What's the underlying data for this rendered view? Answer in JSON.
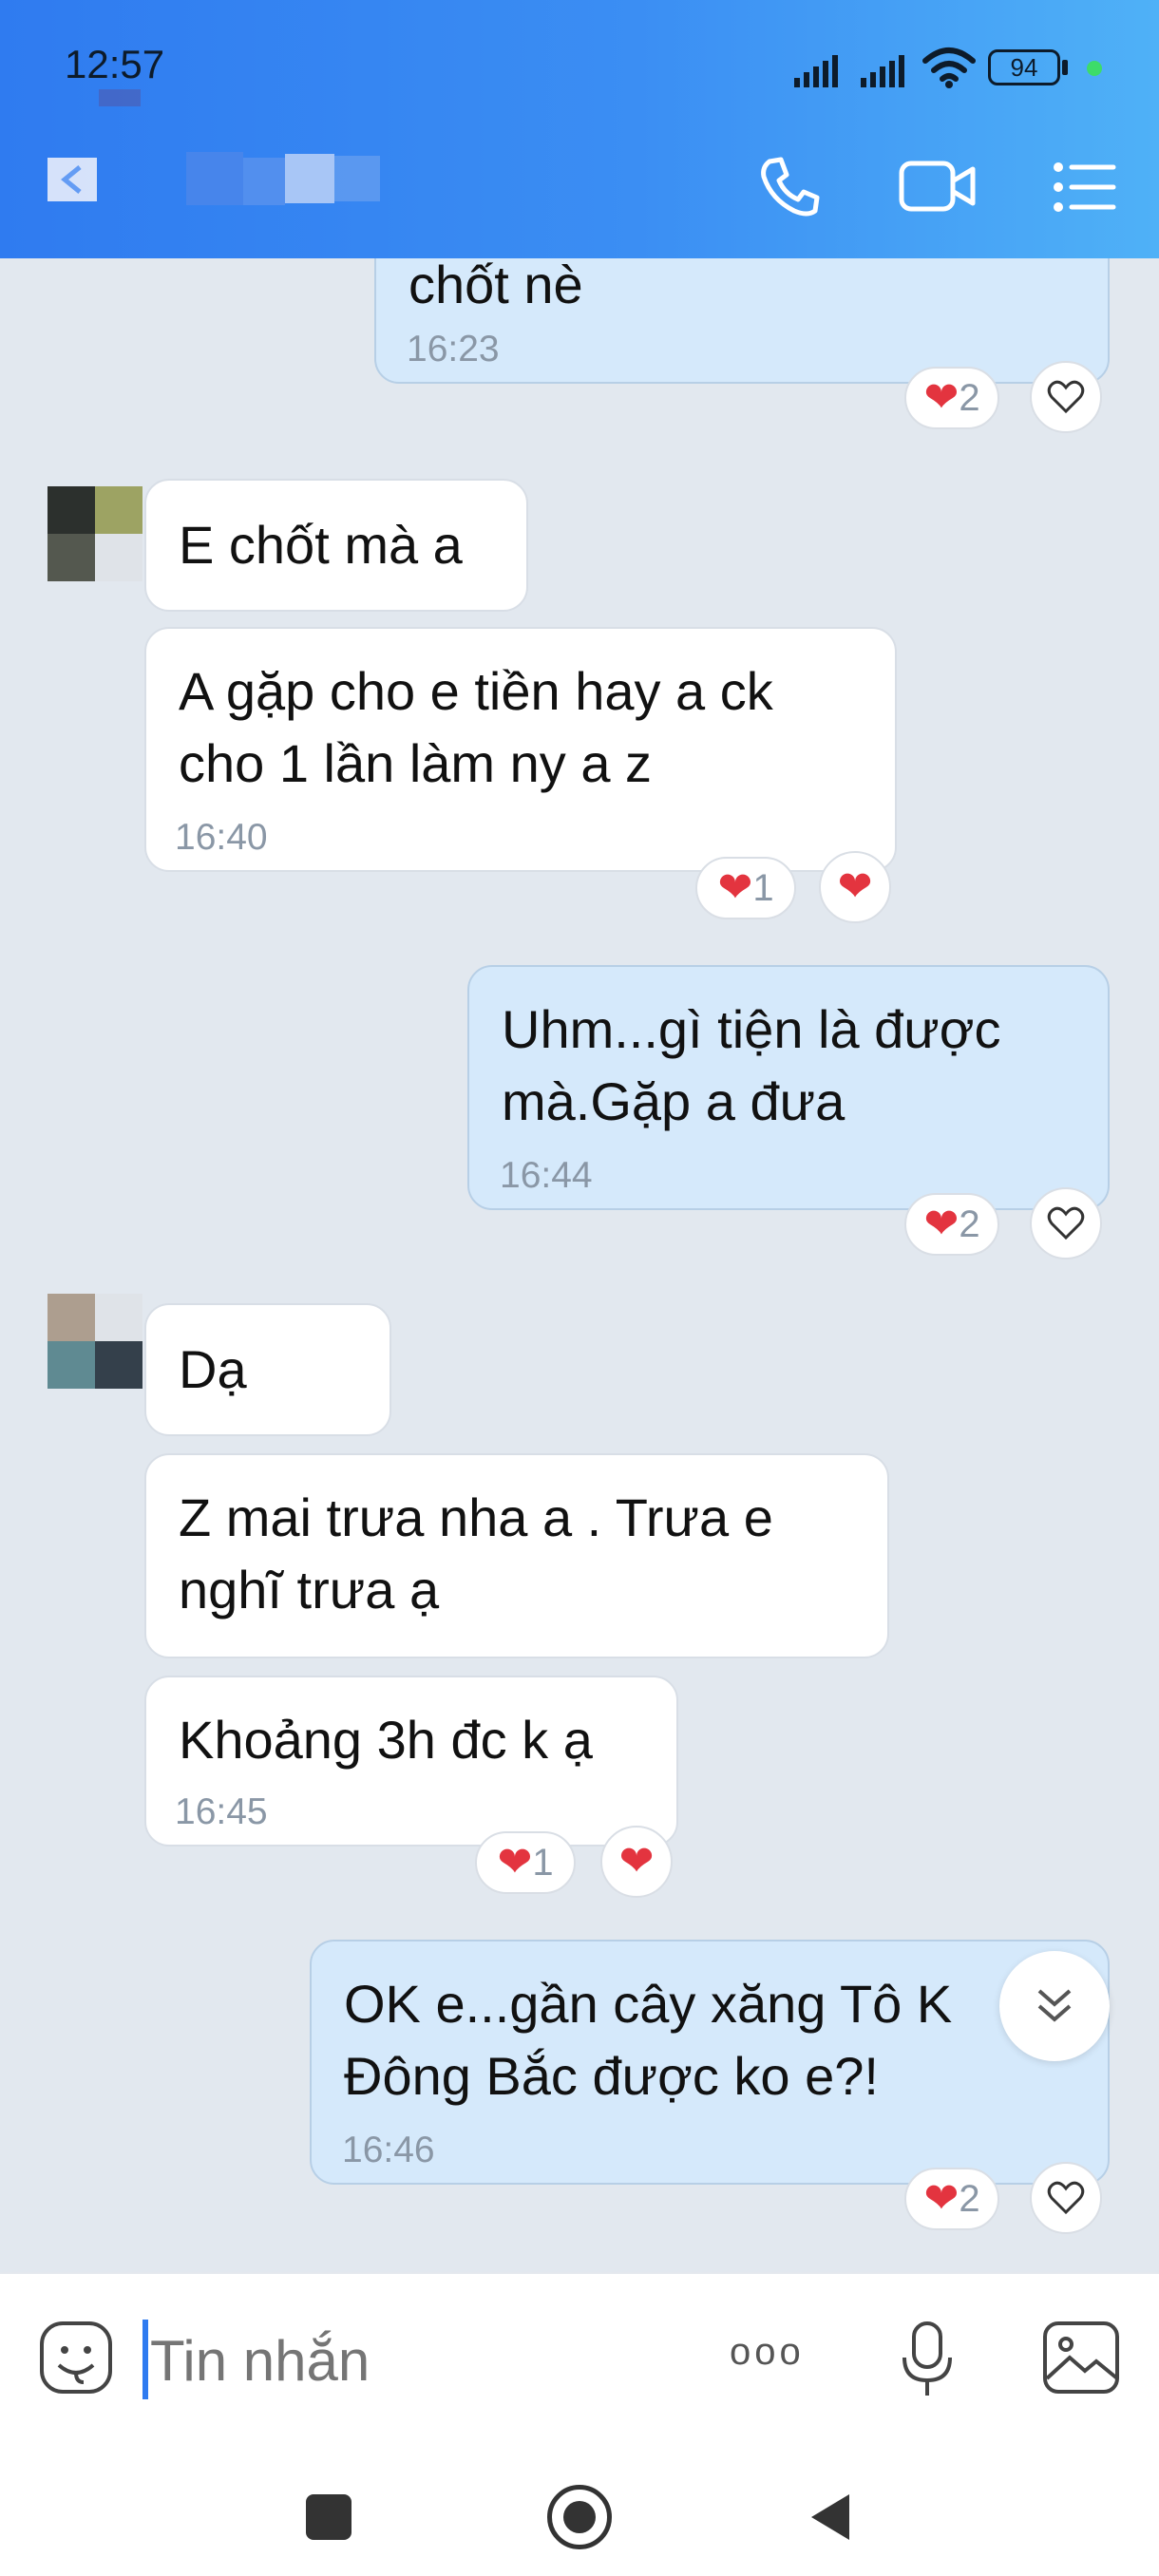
{
  "status_bar": {
    "time": "12:57",
    "battery": "94"
  },
  "header": {
    "back_icon": "back-arrow-icon",
    "call_icon": "phone-icon",
    "video_icon": "video-camera-icon",
    "menu_icon": "menu-list-icon"
  },
  "messages": [
    {
      "line1": "chốt nè",
      "time": "16:23",
      "reaction_count": "2"
    },
    {
      "text": "E chốt mà a"
    },
    {
      "line1": "A gặp cho e tiền hay a ck",
      "line2": "cho 1 lần làm ny a z",
      "time": "16:40",
      "reaction_count": "1"
    },
    {
      "line1": "Uhm...gì tiện là được",
      "line2": "mà.Gặp a đưa",
      "time": "16:44",
      "reaction_count": "2"
    },
    {
      "text": "Dạ"
    },
    {
      "line1": "Z mai trưa nha a . Trưa e",
      "line2": "nghĩ trưa ạ"
    },
    {
      "line1": "Khoảng 3h đc k ạ",
      "time": "16:45",
      "reaction_count": "1"
    },
    {
      "line1": "OK e...gần cây xăng Tô K",
      "line2": "Đông Bắc được ko e?!",
      "time": "16:46",
      "reaction_count": "2"
    }
  ],
  "input": {
    "placeholder": "Tin nhắn",
    "more_label": "ooo"
  },
  "colors": {
    "header_start": "#2f7bf0",
    "header_end": "#4fb1f7",
    "incoming": "#ffffff",
    "outgoing": "#d5e9fb",
    "heart": "#e3343f"
  }
}
